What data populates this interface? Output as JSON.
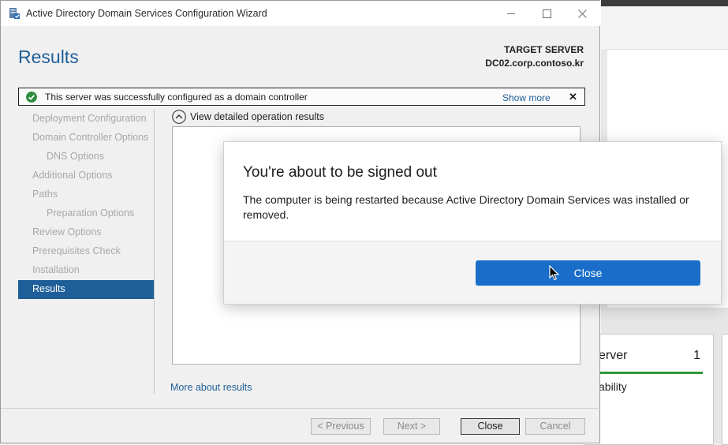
{
  "wizard": {
    "title": "Active Directory Domain Services Configuration Wizard",
    "page_title": "Results",
    "target_label": "TARGET SERVER",
    "target_value": "DC02.corp.contoso.kr",
    "status_message": "This server was successfully configured as a domain controller",
    "show_more": "Show more",
    "status_close": "✕",
    "nav": [
      {
        "label": "Deployment Configuration"
      },
      {
        "label": "Domain Controller Options"
      },
      {
        "label": "DNS Options"
      },
      {
        "label": "Additional Options"
      },
      {
        "label": "Paths"
      },
      {
        "label": "Preparation Options"
      },
      {
        "label": "Review Options"
      },
      {
        "label": "Prerequisites Check"
      },
      {
        "label": "Installation"
      },
      {
        "label": "Results"
      }
    ],
    "details_toggle": "View detailed operation results",
    "more_about": "More about results",
    "buttons": {
      "previous": "< Previous",
      "next": "Next >",
      "close": "Close",
      "cancel": "Cancel"
    }
  },
  "modal": {
    "title": "You're about to be signed out",
    "message": "The computer is being restarted because Active Directory Domain Services was installed or removed.",
    "button": "Close",
    "accent": "#1a6ec9"
  },
  "background": {
    "tile_title": "erver",
    "tile_count": "1",
    "tile_sub": "ability"
  },
  "icons": {
    "status": "check-circle-icon",
    "toggle": "chevron-up-circle-icon",
    "app": "server-wizard-icon"
  }
}
